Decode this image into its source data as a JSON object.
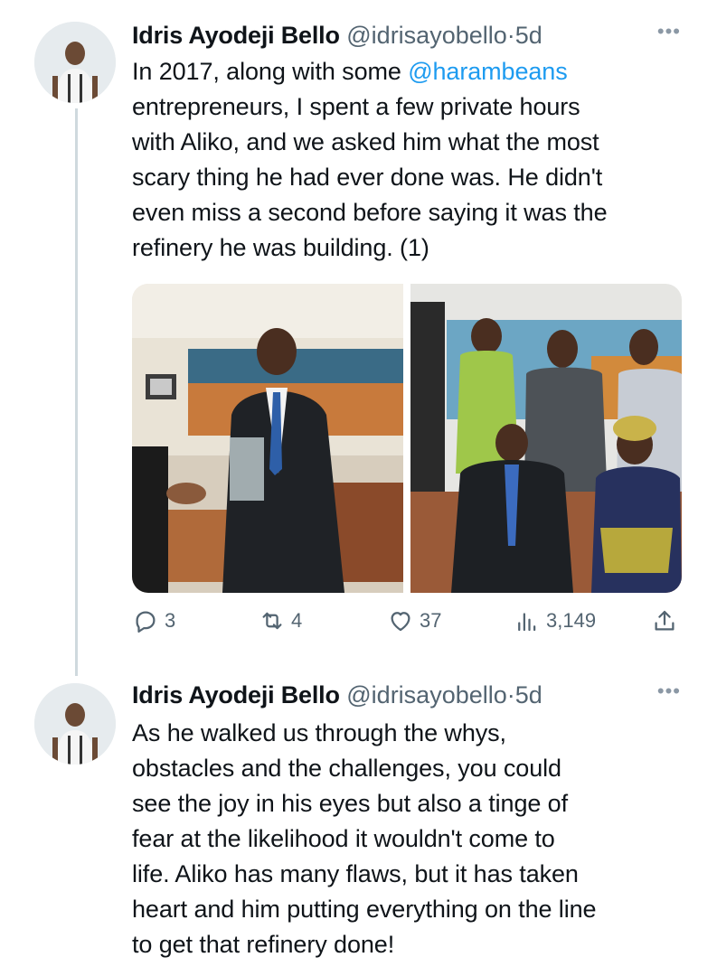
{
  "tweets": [
    {
      "author_name": "Idris Ayodeji Bello",
      "handle": "@idrisayobello",
      "separator": "·",
      "time": "5d",
      "more_icon": "more-horizontal-icon",
      "text_before_mention": "In 2017, along with some ",
      "mention": "@harambeans",
      "text_after_mention": "\nentrepreneurs,  I spent a few private hours\nwith Aliko, and we asked him what the most\nscary thing he had ever done was. He didn't\neven miss a second before saying it was the\nrefinery he was building. (1)",
      "media": [
        {
          "name": "photo-award-presentation"
        },
        {
          "name": "photo-group-seated"
        }
      ],
      "stats": {
        "replies": "3",
        "retweets": "4",
        "likes": "37",
        "views": "3,149"
      }
    },
    {
      "author_name": "Idris Ayodeji Bello",
      "handle": "@idrisayobello",
      "separator": "·",
      "time": "5d",
      "more_icon": "more-horizontal-icon",
      "text": "As he walked us through the whys,\nobstacles and the challenges, you could\nsee the joy in his eyes but also a tinge of\nfear at the likelihood it wouldn't come to\nlife. Aliko has many flaws, but it has taken\nheart and him putting everything on the line\nto get that refinery done!"
    }
  ],
  "colors": {
    "text": "#0f1419",
    "secondary": "#536471",
    "link": "#1d9bf0",
    "thread_line": "#cfd9de"
  }
}
